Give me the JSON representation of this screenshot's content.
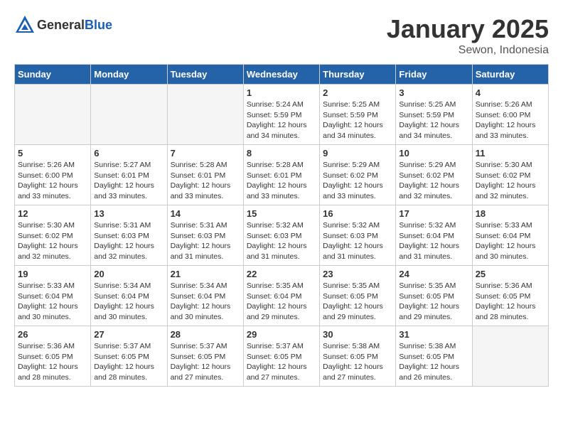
{
  "header": {
    "logo_general": "General",
    "logo_blue": "Blue",
    "title": "January 2025",
    "subtitle": "Sewon, Indonesia"
  },
  "weekdays": [
    "Sunday",
    "Monday",
    "Tuesday",
    "Wednesday",
    "Thursday",
    "Friday",
    "Saturday"
  ],
  "weeks": [
    [
      {
        "day": "",
        "info": ""
      },
      {
        "day": "",
        "info": ""
      },
      {
        "day": "",
        "info": ""
      },
      {
        "day": "1",
        "info": "Sunrise: 5:24 AM\nSunset: 5:59 PM\nDaylight: 12 hours\nand 34 minutes."
      },
      {
        "day": "2",
        "info": "Sunrise: 5:25 AM\nSunset: 5:59 PM\nDaylight: 12 hours\nand 34 minutes."
      },
      {
        "day": "3",
        "info": "Sunrise: 5:25 AM\nSunset: 5:59 PM\nDaylight: 12 hours\nand 34 minutes."
      },
      {
        "day": "4",
        "info": "Sunrise: 5:26 AM\nSunset: 6:00 PM\nDaylight: 12 hours\nand 33 minutes."
      }
    ],
    [
      {
        "day": "5",
        "info": "Sunrise: 5:26 AM\nSunset: 6:00 PM\nDaylight: 12 hours\nand 33 minutes."
      },
      {
        "day": "6",
        "info": "Sunrise: 5:27 AM\nSunset: 6:01 PM\nDaylight: 12 hours\nand 33 minutes."
      },
      {
        "day": "7",
        "info": "Sunrise: 5:28 AM\nSunset: 6:01 PM\nDaylight: 12 hours\nand 33 minutes."
      },
      {
        "day": "8",
        "info": "Sunrise: 5:28 AM\nSunset: 6:01 PM\nDaylight: 12 hours\nand 33 minutes."
      },
      {
        "day": "9",
        "info": "Sunrise: 5:29 AM\nSunset: 6:02 PM\nDaylight: 12 hours\nand 33 minutes."
      },
      {
        "day": "10",
        "info": "Sunrise: 5:29 AM\nSunset: 6:02 PM\nDaylight: 12 hours\nand 32 minutes."
      },
      {
        "day": "11",
        "info": "Sunrise: 5:30 AM\nSunset: 6:02 PM\nDaylight: 12 hours\nand 32 minutes."
      }
    ],
    [
      {
        "day": "12",
        "info": "Sunrise: 5:30 AM\nSunset: 6:02 PM\nDaylight: 12 hours\nand 32 minutes."
      },
      {
        "day": "13",
        "info": "Sunrise: 5:31 AM\nSunset: 6:03 PM\nDaylight: 12 hours\nand 32 minutes."
      },
      {
        "day": "14",
        "info": "Sunrise: 5:31 AM\nSunset: 6:03 PM\nDaylight: 12 hours\nand 31 minutes."
      },
      {
        "day": "15",
        "info": "Sunrise: 5:32 AM\nSunset: 6:03 PM\nDaylight: 12 hours\nand 31 minutes."
      },
      {
        "day": "16",
        "info": "Sunrise: 5:32 AM\nSunset: 6:03 PM\nDaylight: 12 hours\nand 31 minutes."
      },
      {
        "day": "17",
        "info": "Sunrise: 5:32 AM\nSunset: 6:04 PM\nDaylight: 12 hours\nand 31 minutes."
      },
      {
        "day": "18",
        "info": "Sunrise: 5:33 AM\nSunset: 6:04 PM\nDaylight: 12 hours\nand 30 minutes."
      }
    ],
    [
      {
        "day": "19",
        "info": "Sunrise: 5:33 AM\nSunset: 6:04 PM\nDaylight: 12 hours\nand 30 minutes."
      },
      {
        "day": "20",
        "info": "Sunrise: 5:34 AM\nSunset: 6:04 PM\nDaylight: 12 hours\nand 30 minutes."
      },
      {
        "day": "21",
        "info": "Sunrise: 5:34 AM\nSunset: 6:04 PM\nDaylight: 12 hours\nand 30 minutes."
      },
      {
        "day": "22",
        "info": "Sunrise: 5:35 AM\nSunset: 6:04 PM\nDaylight: 12 hours\nand 29 minutes."
      },
      {
        "day": "23",
        "info": "Sunrise: 5:35 AM\nSunset: 6:05 PM\nDaylight: 12 hours\nand 29 minutes."
      },
      {
        "day": "24",
        "info": "Sunrise: 5:35 AM\nSunset: 6:05 PM\nDaylight: 12 hours\nand 29 minutes."
      },
      {
        "day": "25",
        "info": "Sunrise: 5:36 AM\nSunset: 6:05 PM\nDaylight: 12 hours\nand 28 minutes."
      }
    ],
    [
      {
        "day": "26",
        "info": "Sunrise: 5:36 AM\nSunset: 6:05 PM\nDaylight: 12 hours\nand 28 minutes."
      },
      {
        "day": "27",
        "info": "Sunrise: 5:37 AM\nSunset: 6:05 PM\nDaylight: 12 hours\nand 28 minutes."
      },
      {
        "day": "28",
        "info": "Sunrise: 5:37 AM\nSunset: 6:05 PM\nDaylight: 12 hours\nand 27 minutes."
      },
      {
        "day": "29",
        "info": "Sunrise: 5:37 AM\nSunset: 6:05 PM\nDaylight: 12 hours\nand 27 minutes."
      },
      {
        "day": "30",
        "info": "Sunrise: 5:38 AM\nSunset: 6:05 PM\nDaylight: 12 hours\nand 27 minutes."
      },
      {
        "day": "31",
        "info": "Sunrise: 5:38 AM\nSunset: 6:05 PM\nDaylight: 12 hours\nand 26 minutes."
      },
      {
        "day": "",
        "info": ""
      }
    ]
  ]
}
